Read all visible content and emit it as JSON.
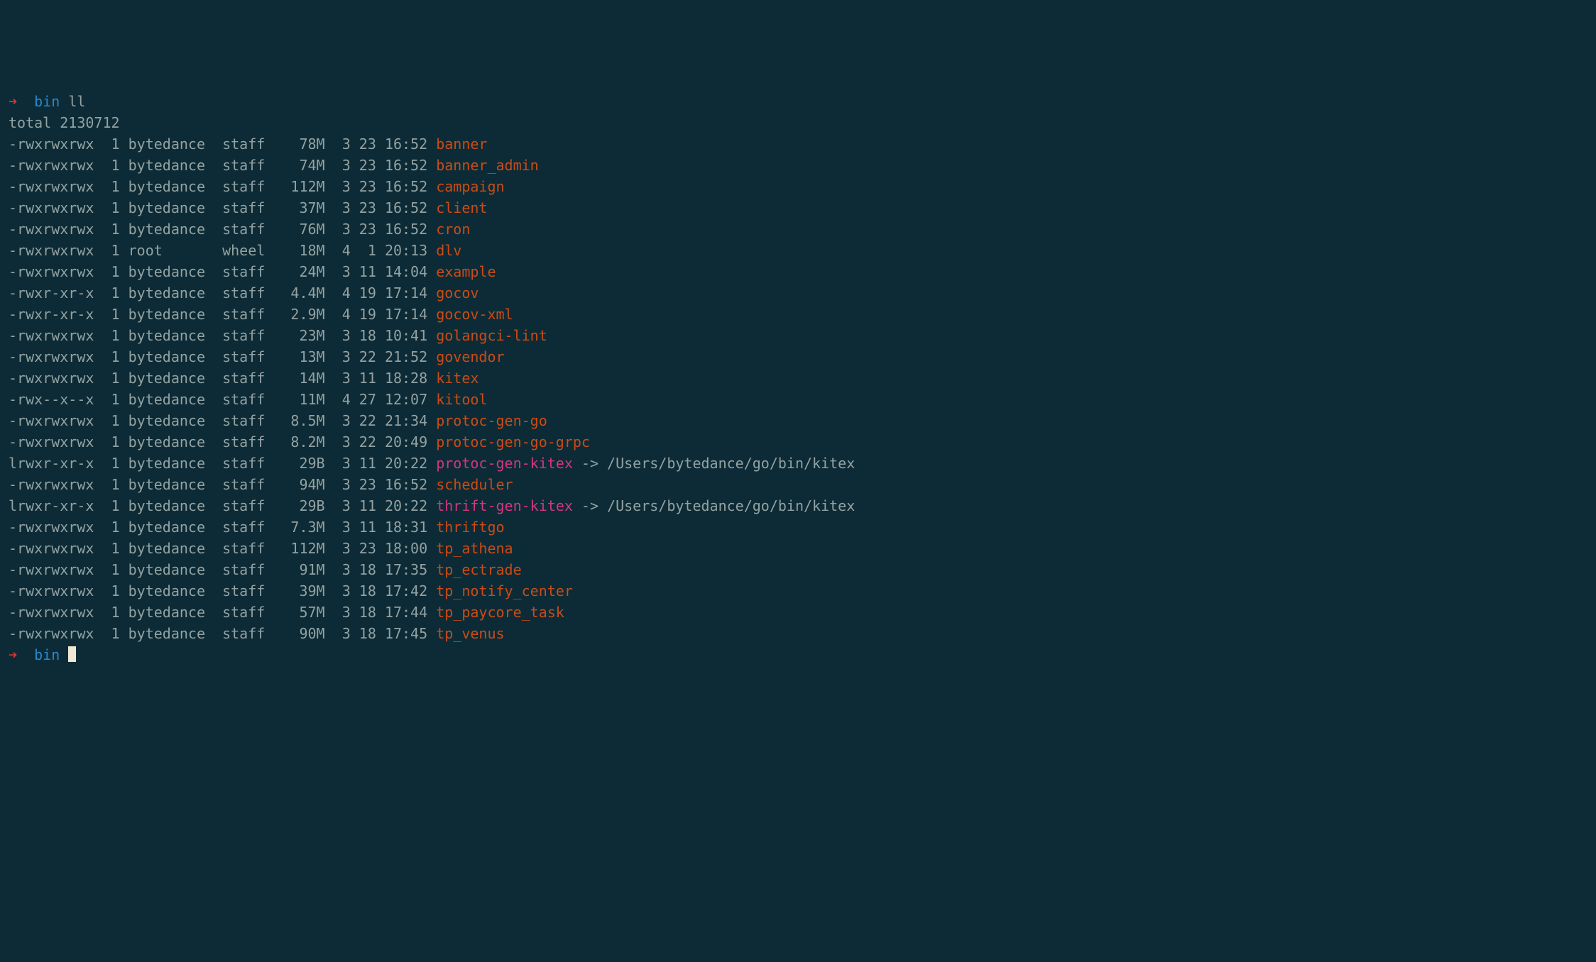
{
  "prompt": {
    "arrow": "➜",
    "dir": "bin",
    "command": "ll"
  },
  "total_label": "total",
  "total_value": "2130712",
  "entries": [
    {
      "perms": "-rwxrwxrwx",
      "links": "1",
      "owner": "bytedance",
      "group": "staff",
      "size": "78M",
      "month": "3",
      "day": "23",
      "time": "16:52",
      "name": "banner",
      "type": "exec"
    },
    {
      "perms": "-rwxrwxrwx",
      "links": "1",
      "owner": "bytedance",
      "group": "staff",
      "size": "74M",
      "month": "3",
      "day": "23",
      "time": "16:52",
      "name": "banner_admin",
      "type": "exec"
    },
    {
      "perms": "-rwxrwxrwx",
      "links": "1",
      "owner": "bytedance",
      "group": "staff",
      "size": "112M",
      "month": "3",
      "day": "23",
      "time": "16:52",
      "name": "campaign",
      "type": "exec"
    },
    {
      "perms": "-rwxrwxrwx",
      "links": "1",
      "owner": "bytedance",
      "group": "staff",
      "size": "37M",
      "month": "3",
      "day": "23",
      "time": "16:52",
      "name": "client",
      "type": "exec"
    },
    {
      "perms": "-rwxrwxrwx",
      "links": "1",
      "owner": "bytedance",
      "group": "staff",
      "size": "76M",
      "month": "3",
      "day": "23",
      "time": "16:52",
      "name": "cron",
      "type": "exec"
    },
    {
      "perms": "-rwxrwxrwx",
      "links": "1",
      "owner": "root",
      "group": "wheel",
      "size": "18M",
      "month": "4",
      "day": "1",
      "time": "20:13",
      "name": "dlv",
      "type": "exec"
    },
    {
      "perms": "-rwxrwxrwx",
      "links": "1",
      "owner": "bytedance",
      "group": "staff",
      "size": "24M",
      "month": "3",
      "day": "11",
      "time": "14:04",
      "name": "example",
      "type": "exec"
    },
    {
      "perms": "-rwxr-xr-x",
      "links": "1",
      "owner": "bytedance",
      "group": "staff",
      "size": "4.4M",
      "month": "4",
      "day": "19",
      "time": "17:14",
      "name": "gocov",
      "type": "exec"
    },
    {
      "perms": "-rwxr-xr-x",
      "links": "1",
      "owner": "bytedance",
      "group": "staff",
      "size": "2.9M",
      "month": "4",
      "day": "19",
      "time": "17:14",
      "name": "gocov-xml",
      "type": "exec"
    },
    {
      "perms": "-rwxrwxrwx",
      "links": "1",
      "owner": "bytedance",
      "group": "staff",
      "size": "23M",
      "month": "3",
      "day": "18",
      "time": "10:41",
      "name": "golangci-lint",
      "type": "exec"
    },
    {
      "perms": "-rwxrwxrwx",
      "links": "1",
      "owner": "bytedance",
      "group": "staff",
      "size": "13M",
      "month": "3",
      "day": "22",
      "time": "21:52",
      "name": "govendor",
      "type": "exec"
    },
    {
      "perms": "-rwxrwxrwx",
      "links": "1",
      "owner": "bytedance",
      "group": "staff",
      "size": "14M",
      "month": "3",
      "day": "11",
      "time": "18:28",
      "name": "kitex",
      "type": "exec"
    },
    {
      "perms": "-rwx--x--x",
      "links": "1",
      "owner": "bytedance",
      "group": "staff",
      "size": "11M",
      "month": "4",
      "day": "27",
      "time": "12:07",
      "name": "kitool",
      "type": "exec"
    },
    {
      "perms": "-rwxrwxrwx",
      "links": "1",
      "owner": "bytedance",
      "group": "staff",
      "size": "8.5M",
      "month": "3",
      "day": "22",
      "time": "21:34",
      "name": "protoc-gen-go",
      "type": "exec"
    },
    {
      "perms": "-rwxrwxrwx",
      "links": "1",
      "owner": "bytedance",
      "group": "staff",
      "size": "8.2M",
      "month": "3",
      "day": "22",
      "time": "20:49",
      "name": "protoc-gen-go-grpc",
      "type": "exec"
    },
    {
      "perms": "lrwxr-xr-x",
      "links": "1",
      "owner": "bytedance",
      "group": "staff",
      "size": "29B",
      "month": "3",
      "day": "11",
      "time": "20:22",
      "name": "protoc-gen-kitex",
      "type": "symlink",
      "target": "/Users/bytedance/go/bin/kitex"
    },
    {
      "perms": "-rwxrwxrwx",
      "links": "1",
      "owner": "bytedance",
      "group": "staff",
      "size": "94M",
      "month": "3",
      "day": "23",
      "time": "16:52",
      "name": "scheduler",
      "type": "exec"
    },
    {
      "perms": "lrwxr-xr-x",
      "links": "1",
      "owner": "bytedance",
      "group": "staff",
      "size": "29B",
      "month": "3",
      "day": "11",
      "time": "20:22",
      "name": "thrift-gen-kitex",
      "type": "symlink",
      "target": "/Users/bytedance/go/bin/kitex"
    },
    {
      "perms": "-rwxrwxrwx",
      "links": "1",
      "owner": "bytedance",
      "group": "staff",
      "size": "7.3M",
      "month": "3",
      "day": "11",
      "time": "18:31",
      "name": "thriftgo",
      "type": "exec"
    },
    {
      "perms": "-rwxrwxrwx",
      "links": "1",
      "owner": "bytedance",
      "group": "staff",
      "size": "112M",
      "month": "3",
      "day": "23",
      "time": "18:00",
      "name": "tp_athena",
      "type": "exec"
    },
    {
      "perms": "-rwxrwxrwx",
      "links": "1",
      "owner": "bytedance",
      "group": "staff",
      "size": "91M",
      "month": "3",
      "day": "18",
      "time": "17:35",
      "name": "tp_ectrade",
      "type": "exec"
    },
    {
      "perms": "-rwxrwxrwx",
      "links": "1",
      "owner": "bytedance",
      "group": "staff",
      "size": "39M",
      "month": "3",
      "day": "18",
      "time": "17:42",
      "name": "tp_notify_center",
      "type": "exec"
    },
    {
      "perms": "-rwxrwxrwx",
      "links": "1",
      "owner": "bytedance",
      "group": "staff",
      "size": "57M",
      "month": "3",
      "day": "18",
      "time": "17:44",
      "name": "tp_paycore_task",
      "type": "exec"
    },
    {
      "perms": "-rwxrwxrwx",
      "links": "1",
      "owner": "bytedance",
      "group": "staff",
      "size": "90M",
      "month": "3",
      "day": "18",
      "time": "17:45",
      "name": "tp_venus",
      "type": "exec"
    }
  ],
  "link_arrow": "->"
}
